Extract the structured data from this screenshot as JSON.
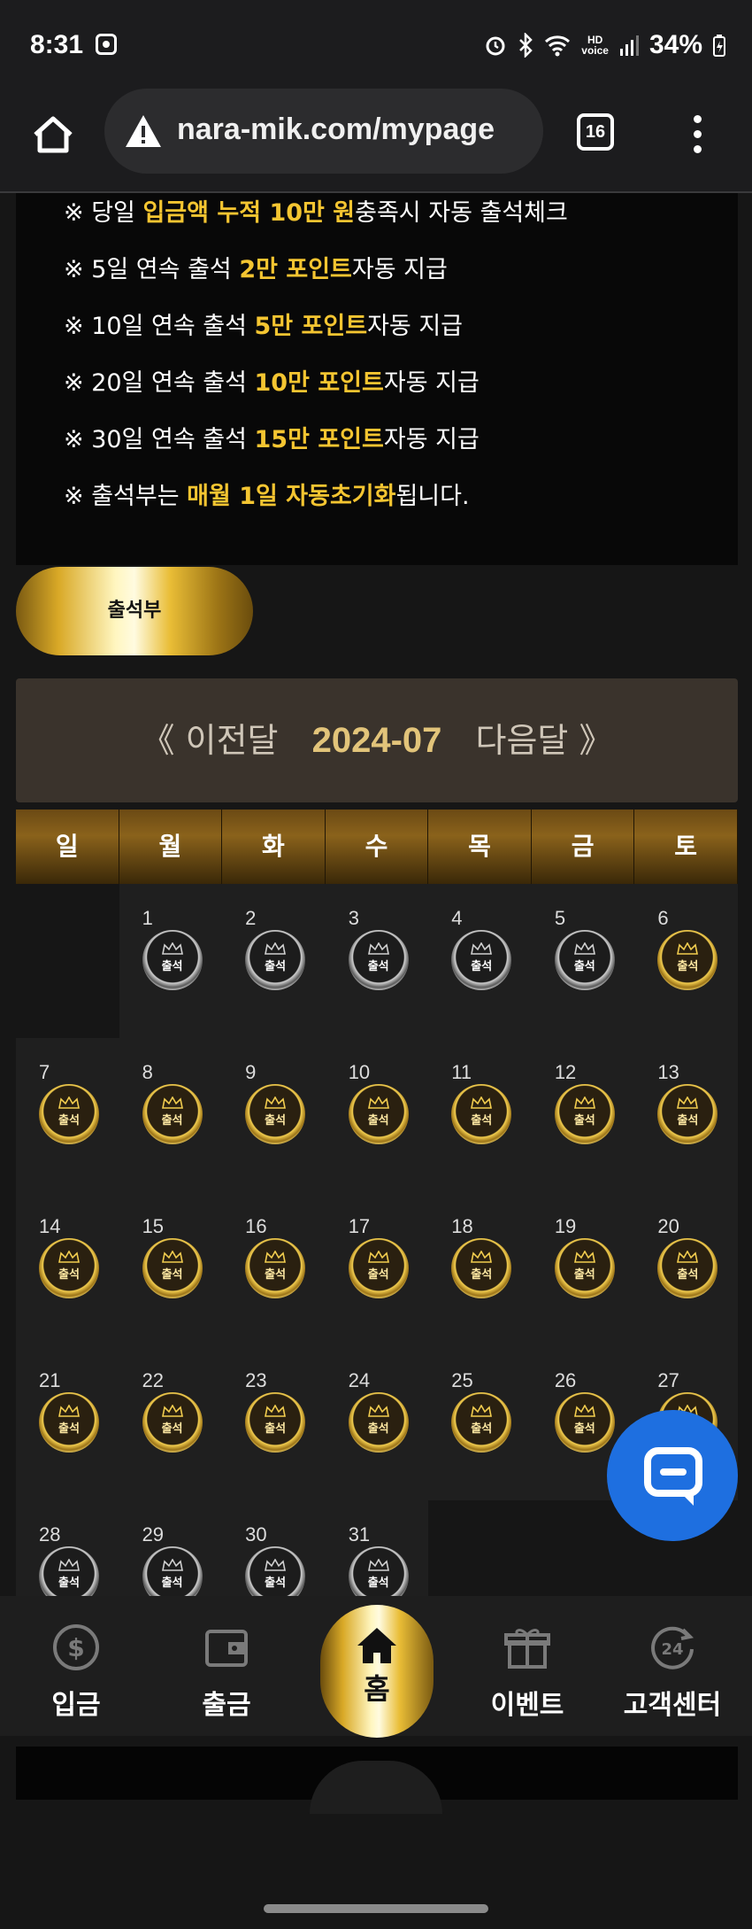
{
  "status_bar": {
    "time": "8:31",
    "hd_top": "HD",
    "hd_bottom": "voice",
    "battery": "34%"
  },
  "browser": {
    "url": "nara-mik.com/mypage",
    "tab_count": "16"
  },
  "notice": {
    "lines": [
      {
        "pre": "※ 당일 ",
        "hl": "입금액 누적 10만 원",
        "post": "충족시 자동 출석체크"
      },
      {
        "pre": "※ 5일 연속 출석 ",
        "hl": "2만 포인트",
        "post": "자동 지급"
      },
      {
        "pre": "※ 10일 연속 출석 ",
        "hl": "5만 포인트",
        "post": "자동 지급"
      },
      {
        "pre": "※ 20일 연속 출석 ",
        "hl": "10만 포인트",
        "post": "자동 지급"
      },
      {
        "pre": "※ 30일 연속 출석 ",
        "hl": "15만 포인트",
        "post": "자동 지급"
      },
      {
        "pre": "※ 출석부는 ",
        "hl": "매월 1일 자동초기화",
        "post": "됩니다."
      }
    ]
  },
  "attendance_button": "출석부",
  "calendar": {
    "prev_label": "《 이전달",
    "year_month": "2024-07",
    "next_label": "다음달 》",
    "weekdays": [
      "일",
      "월",
      "화",
      "수",
      "목",
      "금",
      "토"
    ],
    "stamp_label": "출석",
    "days": [
      {
        "day": "1",
        "status": "grey"
      },
      {
        "day": "2",
        "status": "grey"
      },
      {
        "day": "3",
        "status": "grey"
      },
      {
        "day": "4",
        "status": "grey"
      },
      {
        "day": "5",
        "status": "grey"
      },
      {
        "day": "6",
        "status": "gold"
      },
      {
        "day": "7",
        "status": "gold"
      },
      {
        "day": "8",
        "status": "gold"
      },
      {
        "day": "9",
        "status": "gold"
      },
      {
        "day": "10",
        "status": "gold"
      },
      {
        "day": "11",
        "status": "gold"
      },
      {
        "day": "12",
        "status": "gold"
      },
      {
        "day": "13",
        "status": "gold"
      },
      {
        "day": "14",
        "status": "gold"
      },
      {
        "day": "15",
        "status": "gold"
      },
      {
        "day": "16",
        "status": "gold"
      },
      {
        "day": "17",
        "status": "gold"
      },
      {
        "day": "18",
        "status": "gold"
      },
      {
        "day": "19",
        "status": "gold"
      },
      {
        "day": "20",
        "status": "gold"
      },
      {
        "day": "21",
        "status": "gold"
      },
      {
        "day": "22",
        "status": "gold"
      },
      {
        "day": "23",
        "status": "gold"
      },
      {
        "day": "24",
        "status": "gold"
      },
      {
        "day": "25",
        "status": "gold"
      },
      {
        "day": "26",
        "status": "gold"
      },
      {
        "day": "27",
        "status": "gold"
      },
      {
        "day": "28",
        "status": "grey"
      },
      {
        "day": "29",
        "status": "grey"
      },
      {
        "day": "30",
        "status": "grey"
      },
      {
        "day": "31",
        "status": "grey"
      }
    ]
  },
  "bottom_nav": {
    "deposit": "입금",
    "withdraw": "출금",
    "home": "홈",
    "event": "이벤트",
    "support": "고객센터"
  },
  "colors": {
    "accent_gold": "#f4c531",
    "chat_blue": "#1e6fe0",
    "month_bar": "#3a332c"
  }
}
